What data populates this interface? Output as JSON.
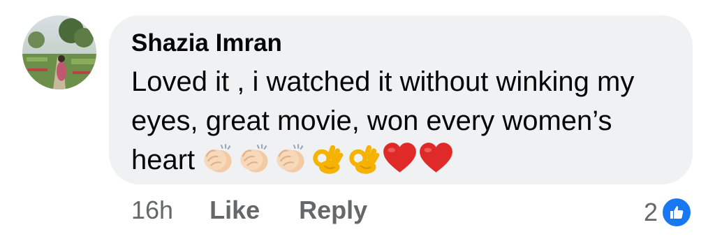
{
  "comment": {
    "author": "Shazia Imran",
    "text": "Loved it , i watched it without winking my eyes, great movie, won every women’s heart",
    "emojis": [
      "clapping-hands",
      "clapping-hands",
      "clapping-hands",
      "ok-hand",
      "ok-hand",
      "red-heart",
      "red-heart"
    ],
    "timestamp": "16h",
    "like_label": "Like",
    "reply_label": "Reply",
    "reaction_count": "2",
    "reaction_type": "like-icon"
  },
  "colors": {
    "bubble": "#eff1f3",
    "secondary_text": "#65676b",
    "like_blue": "#1877f2",
    "heart_red": "#e02a2a"
  }
}
